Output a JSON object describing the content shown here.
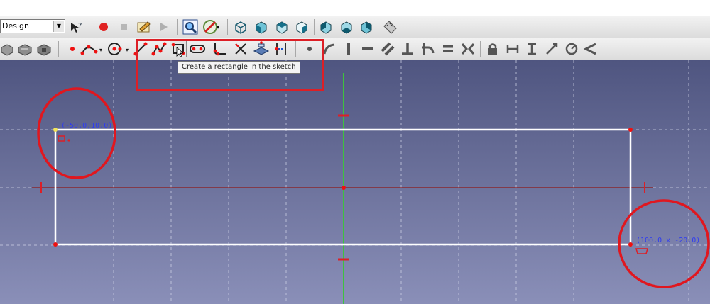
{
  "workbench_combo": {
    "value": "Design"
  },
  "tooltip": {
    "text": "Create a rectangle in the sketch"
  },
  "sketch": {
    "corner_start_label": "(-50.0,10.0)",
    "corner_end_label": "(100.0 x -20.0)"
  },
  "toolbar_row1_icons": [
    "whats-this-icon",
    "record-macro-icon",
    "stop-macro-icon",
    "edit-macro-icon",
    "run-macro-icon",
    "fit-all-icon",
    "draw-style-icon",
    "isometric-view-icon",
    "front-view-icon",
    "top-view-icon",
    "right-view-icon",
    "rear-view-icon",
    "bottom-view-icon",
    "left-view-icon",
    "measure-icon"
  ],
  "toolbar_row2_icons": [
    "sketch-icon",
    "point-icon",
    "arc-icon",
    "circle-icon",
    "line-icon",
    "polyline-icon",
    "rectangle-icon",
    "slot-icon",
    "fillet-icon",
    "trim-icon",
    "external-geometry-icon",
    "construction-mode-icon",
    "coincident-icon",
    "point-on-object-icon",
    "vertical-icon",
    "horizontal-icon",
    "parallel-icon",
    "perpendicular-icon",
    "tangent-icon",
    "equal-icon",
    "symmetric-icon",
    "lock-icon",
    "horizontal-distance-icon",
    "vertical-distance-icon",
    "distance-icon",
    "radius-icon",
    "angle-icon"
  ],
  "colors": {
    "background_top": "#4f5580",
    "background_bottom": "#8a8fb8",
    "geometry": "#ffffff",
    "annotation": "#dd1f26",
    "y_axis": "#3ec23e",
    "x_axis": "#8f1a1a"
  }
}
